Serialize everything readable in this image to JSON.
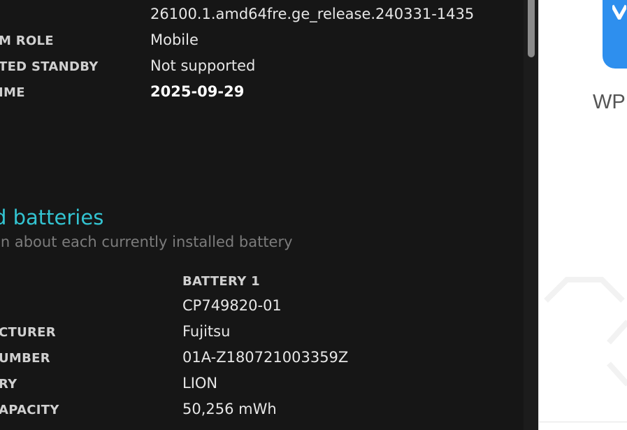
{
  "system_rows": [
    {
      "label": "",
      "value": "26100.1.amd64fre.ge_release.240331-1435"
    },
    {
      "label": "M ROLE",
      "value": "Mobile"
    },
    {
      "label": "TED STANDBY",
      "value": "Not supported"
    },
    {
      "label": "IME",
      "value": "2025-09-29"
    }
  ],
  "batteries_section": {
    "title": "d batteries",
    "subtitle": "on about each currently installed battery",
    "column_header": "BATTERY 1",
    "rows": [
      {
        "label": "",
        "value": "CP749820-01"
      },
      {
        "label": "CTURER",
        "value": "Fujitsu"
      },
      {
        "label": "UMBER",
        "value": "01A-Z180721003359Z"
      },
      {
        "label": "RY",
        "value": "LION"
      },
      {
        "label": "APACITY",
        "value": "50,256 mWh"
      }
    ]
  },
  "side_panel": {
    "app_name": "WP",
    "app_icon": "app-logo-icon"
  },
  "colors": {
    "background": "#161616",
    "accent": "#33c4d2",
    "app_tile": "#2e8fee"
  }
}
